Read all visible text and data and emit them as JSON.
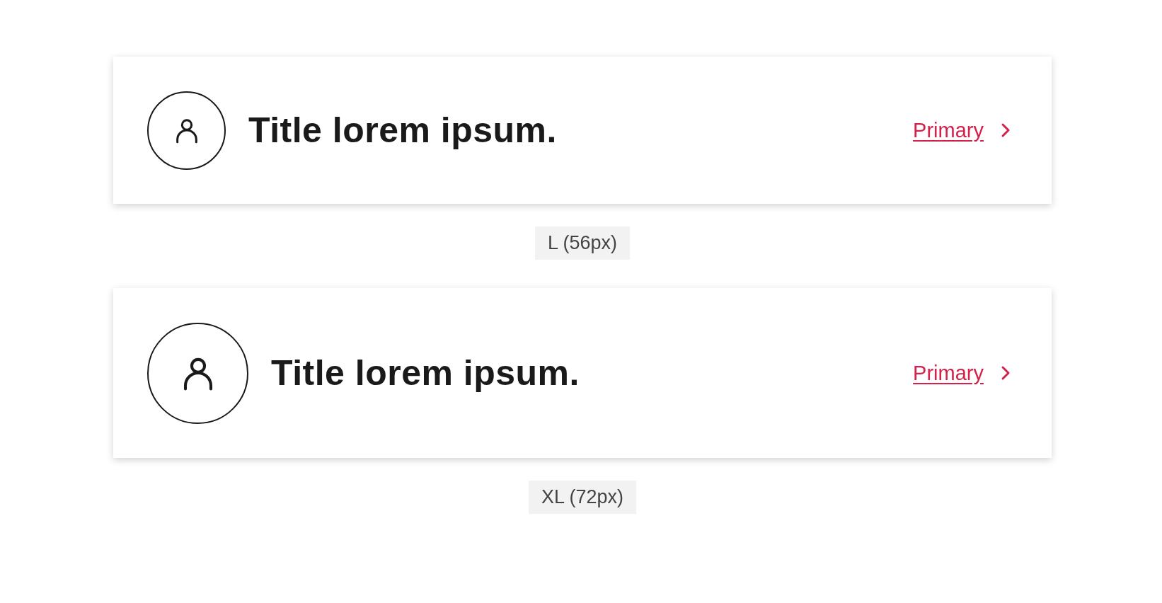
{
  "variants": [
    {
      "kind": "large",
      "title": "Title lorem ipsum.",
      "link": "Primary",
      "caption": "L (56px)"
    },
    {
      "kind": "xlarge",
      "title": "Title lorem ipsum.",
      "link": "Primary",
      "caption": "XL (72px)"
    }
  ]
}
